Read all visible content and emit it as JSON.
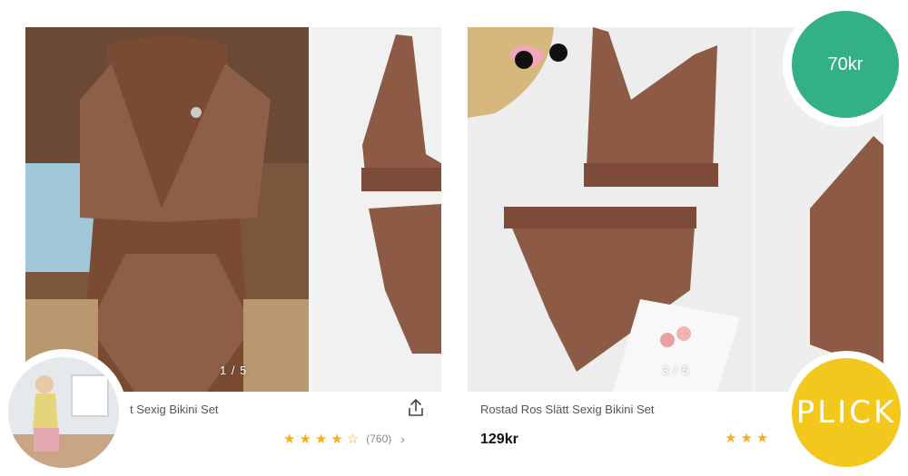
{
  "products": [
    {
      "title": "t Sexig Bikini Set",
      "image_counter": "1 / 5",
      "rating_count": "(760)",
      "rating_stars": 4.5
    },
    {
      "title": "Rostad Ros Slätt Sexig Bikini Set",
      "image_counter": "3 / 5",
      "price": "129kr",
      "rating_stars": 3
    }
  ],
  "badges": {
    "price": "70kr",
    "plick": "PLICK"
  },
  "colors": {
    "price_badge": "#34b086",
    "plick_badge": "#f3c81c",
    "star": "#f2b01e",
    "fabric": "#8a5a44"
  },
  "icons": {
    "share": "share-icon",
    "chevron": "chevron-right-icon",
    "star": "star-icon"
  }
}
